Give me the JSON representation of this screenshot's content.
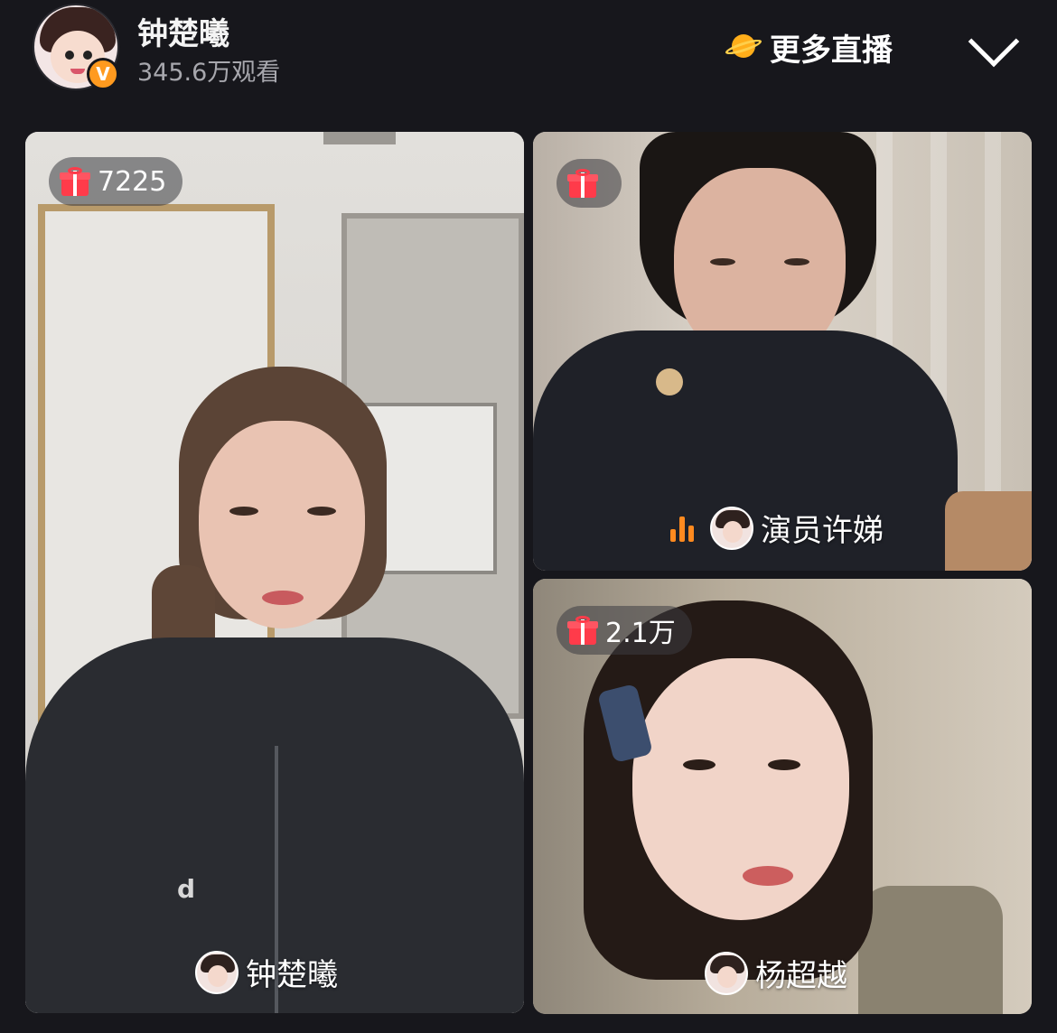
{
  "header": {
    "host_name": "钟楚曦",
    "viewer_count": "345.6万观看",
    "more_live_label": "更多直播",
    "verified_mark": "V"
  },
  "panels": [
    {
      "position": "main-left",
      "gift_count": "7225",
      "name": "钟楚曦",
      "logo_text": "d"
    },
    {
      "position": "top-right",
      "gift_count": "",
      "name": "演员许娣",
      "speaking": true
    },
    {
      "position": "bottom-right",
      "gift_count": "2.1万",
      "name": "杨超越"
    }
  ],
  "colors": {
    "background": "#17171c",
    "accent_orange": "#ff9a1f",
    "gift_red": "#ff3b4a"
  },
  "icons": {
    "more_live": "planet-icon",
    "collapse": "chevron-down-icon",
    "gift": "gift-icon",
    "speaking": "speaking-icon"
  }
}
